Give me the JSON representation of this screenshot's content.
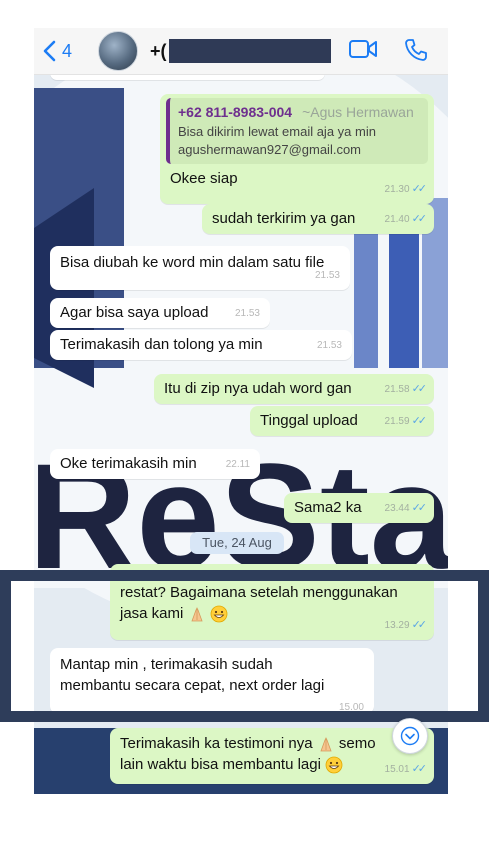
{
  "header": {
    "back_count": "4",
    "contact_prefix": "+(",
    "icons": [
      "chevron-left-icon",
      "video-call-icon",
      "phone-icon"
    ],
    "accent_color": "#1c7cf4"
  },
  "messages": [
    {
      "id": "m1",
      "direction": "out",
      "quote_number": "+62 811-8983-004",
      "quote_alias": "~Agus Hermawan",
      "quote_line1": "Bisa dikirim lewat email aja ya min",
      "quote_line2": "agushermawan927@gmail.com",
      "text": "Okee siap",
      "time": "21.30"
    },
    {
      "id": "m2",
      "direction": "out",
      "text": "sudah terkirim ya gan",
      "time": "21.40"
    },
    {
      "id": "m3",
      "direction": "in",
      "text": "Bisa diubah ke word min dalam satu file",
      "time": "21.53"
    },
    {
      "id": "m4",
      "direction": "in",
      "text": "Agar bisa saya upload",
      "time": "21.53"
    },
    {
      "id": "m5",
      "direction": "in",
      "text": "Terimakasih dan tolong ya min",
      "time": "21.53"
    },
    {
      "id": "m6",
      "direction": "out",
      "text": "Itu di zip nya udah word gan",
      "time": "21.58"
    },
    {
      "id": "m7",
      "direction": "out",
      "text": "Tinggal upload",
      "time": "21.59"
    },
    {
      "id": "m8",
      "direction": "in",
      "text": "Oke terimakasih min",
      "time": "22.11"
    },
    {
      "id": "m9",
      "direction": "out",
      "text": "Sama2 ka",
      "time": "23.44"
    },
    {
      "id": "m10",
      "direction": "out",
      "line1": "restat? Bagaimana setelah menggunakan",
      "line2": "jasa kami",
      "time": "13.29"
    },
    {
      "id": "m11",
      "direction": "in",
      "line1": "Mantap min , terimakasih sudah",
      "line2": "membantu secara cepat, next order lagi",
      "time": "15.00"
    },
    {
      "id": "m12",
      "direction": "out",
      "line1": "Terimakasih ka testimoni nya",
      "line1_tail": "semo",
      "line2": "lain waktu bisa membantu lagi",
      "time": "15.01"
    }
  ],
  "date_separator": "Tue, 24 Aug",
  "tick_glyph": "✓✓",
  "colors": {
    "outgoing_bubble": "#dcf7c5",
    "incoming_bubble": "#ffffff",
    "read_tick": "#5aa6e6",
    "highlight_frame": "#2e3d5a",
    "quote_accent": "#6e2f8e"
  }
}
